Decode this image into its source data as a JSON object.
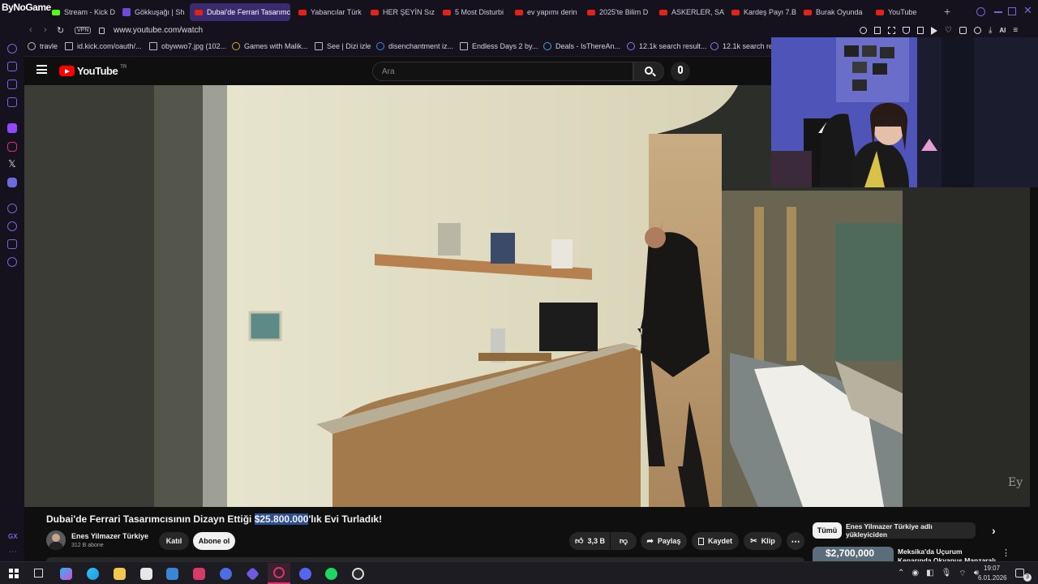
{
  "browser": {
    "brand": "ByNoGame",
    "tabs": [
      "Stream - Kick D",
      "Gökkuşağı | Sh",
      "Dubai'de Ferrari Tasarımc",
      "Yabancılar Türk",
      "HER ŞEYİN Sız",
      "5 Most Disturbi",
      "ev yapımı derin",
      "2025'te Bilim D",
      "ASKERLER, SAV",
      "Kardeş Payı 7.B",
      "Burak Oyunda",
      "YouTube"
    ],
    "vpn": "VPN",
    "url": "www.youtube.com/watch",
    "bookmarks": [
      "travle",
      "id.kick.com/oauth/...",
      "obywwo7.jpg (102...",
      "Games with Malik...",
      "See | Dizi izle",
      "disenchantment iz...",
      "Endless Days 2 by...",
      "Deals - IsThereAn...",
      "12.1k search result...",
      "12.1k search resu"
    ],
    "sidebar_bottom": "GX"
  },
  "youtube": {
    "logo": "YouTube",
    "country": "TR",
    "search_placeholder": "Ara",
    "watermark": "Ey",
    "title_before": "Dubai'de Ferrari Tasarımcısının Dizayn Ettiği ",
    "title_highlight": "$25.800.000",
    "title_after": "'lık Evi Turladık!",
    "channel_name": "Enes Yilmazer Türkiye",
    "subscribers": "312 B abone",
    "join_label": "Katıl",
    "subscribe_label": "Abone ol",
    "likes": "3,3 B",
    "share_label": "Paylaş",
    "save_label": "Kaydet",
    "clip_label": "Klip",
    "chip_all": "Tümü",
    "chip_channel": "Enes Yilmazer Türkiye adlı yükleyiciden",
    "rec_price": "$2,700,000",
    "rec_title": "Meksika'da Uçurum Kenarında Okyanus Manzaralı İnanılmaz"
  },
  "taskbar": {
    "time": "19:07",
    "date": "6.01.2026",
    "notifications": "3"
  }
}
